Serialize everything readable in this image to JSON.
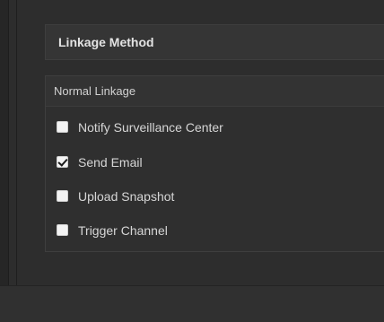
{
  "section": {
    "title": "Linkage Method"
  },
  "panel": {
    "heading": "Normal Linkage",
    "options": [
      {
        "label": "Notify Surveillance Center",
        "checked": false
      },
      {
        "label": "Send Email",
        "checked": true
      },
      {
        "label": "Upload Snapshot",
        "checked": false
      },
      {
        "label": "Trigger Channel",
        "checked": false
      }
    ]
  }
}
